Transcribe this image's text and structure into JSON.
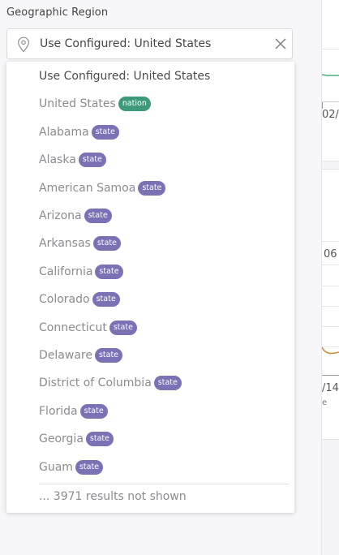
{
  "field": {
    "label": "Geographic Region",
    "value": "Use Configured: United States",
    "icons": {
      "location": "map-pin-icon",
      "clear": "close-icon"
    }
  },
  "dropdown": {
    "items": [
      {
        "name": "Use Configured: United States",
        "badge": null
      },
      {
        "name": "United States",
        "badge": "nation"
      },
      {
        "name": "Alabama",
        "badge": "state"
      },
      {
        "name": "Alaska",
        "badge": "state"
      },
      {
        "name": "American Samoa",
        "badge": "state"
      },
      {
        "name": "Arizona",
        "badge": "state"
      },
      {
        "name": "Arkansas",
        "badge": "state"
      },
      {
        "name": "California",
        "badge": "state"
      },
      {
        "name": "Colorado",
        "badge": "state"
      },
      {
        "name": "Connecticut",
        "badge": "state"
      },
      {
        "name": "Delaware",
        "badge": "state"
      },
      {
        "name": "District of Columbia",
        "badge": "state"
      },
      {
        "name": "Florida",
        "badge": "state"
      },
      {
        "name": "Georgia",
        "badge": "state"
      },
      {
        "name": "Guam",
        "badge": "state"
      }
    ],
    "more_results": "... 3971 results not shown"
  },
  "background_peek": {
    "label_a": "02/",
    "label_b": "06",
    "label_c": "/14",
    "label_d": "e"
  },
  "colors": {
    "nation_badge": "#3f9a7b",
    "state_badge": "#7a72b5",
    "chart_line_green": "#4caf7d",
    "chart_line_orange": "#c98a3a"
  }
}
